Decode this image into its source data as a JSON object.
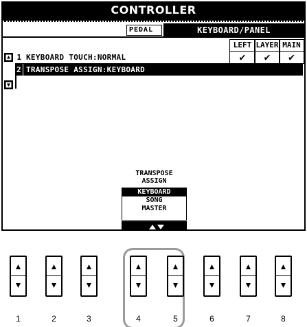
{
  "screen": {
    "title": "CONTROLLER",
    "tabs": {
      "pedal": "PEDAL",
      "keyboard_panel": "KEYBOARD/PANEL"
    },
    "columns": [
      "LEFT",
      "LAYER",
      "MAIN"
    ],
    "check_mark": "✔",
    "rows": [
      {
        "num": "1",
        "label": "KEYBOARD TOUCH:NORMAL"
      },
      {
        "num": "2",
        "label": "TRANSPOSE ASSIGN:KEYBOARD"
      }
    ],
    "selector": {
      "caption_line1": "TRANSPOSE",
      "caption_line2": "ASSIGN",
      "options": [
        "KEYBOARD",
        "SONG",
        "MASTER"
      ],
      "selected": "KEYBOARD"
    }
  },
  "panel_buttons": [
    "1",
    "2",
    "3",
    "4",
    "5",
    "6",
    "7",
    "8"
  ],
  "highlighted_buttons": [
    "4",
    "5"
  ]
}
